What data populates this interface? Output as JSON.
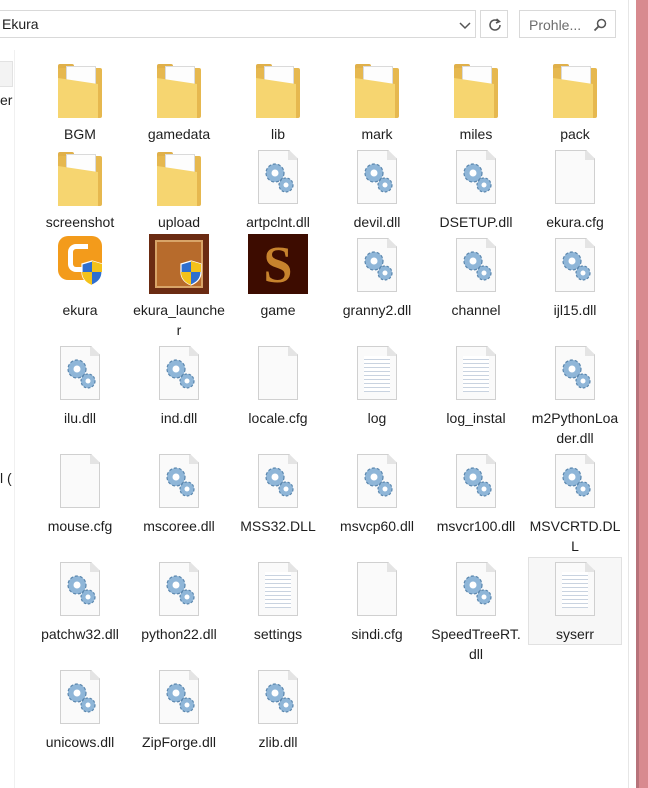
{
  "toolbar": {
    "address": "Ekura",
    "search_placeholder": "Prohle..."
  },
  "nav": {
    "fragment1": "er",
    "fragment2": "l ("
  },
  "items": [
    {
      "name": "BGM",
      "type": "folder"
    },
    {
      "name": "gamedata",
      "type": "folder"
    },
    {
      "name": "lib",
      "type": "folder"
    },
    {
      "name": "mark",
      "type": "folder"
    },
    {
      "name": "miles",
      "type": "folder"
    },
    {
      "name": "pack",
      "type": "folder"
    },
    {
      "name": "screenshot",
      "type": "folder"
    },
    {
      "name": "upload",
      "type": "folder"
    },
    {
      "name": "artpclnt.dll",
      "type": "dll"
    },
    {
      "name": "devil.dll",
      "type": "dll"
    },
    {
      "name": "DSETUP.dll",
      "type": "dll"
    },
    {
      "name": "ekura.cfg",
      "type": "file"
    },
    {
      "name": "ekura",
      "type": "app-ekura"
    },
    {
      "name": "ekura_launcher",
      "type": "app-launcher"
    },
    {
      "name": "game",
      "type": "app-game"
    },
    {
      "name": "granny2.dll",
      "type": "dll"
    },
    {
      "name": "channel",
      "type": "gear-doc"
    },
    {
      "name": "ijl15.dll",
      "type": "dll"
    },
    {
      "name": "ilu.dll",
      "type": "dll"
    },
    {
      "name": "ind.dll",
      "type": "dll"
    },
    {
      "name": "locale.cfg",
      "type": "file"
    },
    {
      "name": "log",
      "type": "text"
    },
    {
      "name": "log_instal",
      "type": "text"
    },
    {
      "name": "m2PythonLoader.dll",
      "type": "dll"
    },
    {
      "name": "mouse.cfg",
      "type": "file"
    },
    {
      "name": "mscoree.dll",
      "type": "dll"
    },
    {
      "name": "MSS32.DLL",
      "type": "dll"
    },
    {
      "name": "msvcp60.dll",
      "type": "dll"
    },
    {
      "name": "msvcr100.dll",
      "type": "dll"
    },
    {
      "name": "MSVCRTD.DLL",
      "type": "dll"
    },
    {
      "name": "patchw32.dll",
      "type": "dll"
    },
    {
      "name": "python22.dll",
      "type": "dll"
    },
    {
      "name": "settings",
      "type": "text"
    },
    {
      "name": "sindi.cfg",
      "type": "file"
    },
    {
      "name": "SpeedTreeRT.dll",
      "type": "dll"
    },
    {
      "name": "syserr",
      "type": "text",
      "selected": true
    },
    {
      "name": "unicows.dll",
      "type": "dll"
    },
    {
      "name": "ZipForge.dll",
      "type": "dll"
    },
    {
      "name": "zlib.dll",
      "type": "dll"
    }
  ]
}
